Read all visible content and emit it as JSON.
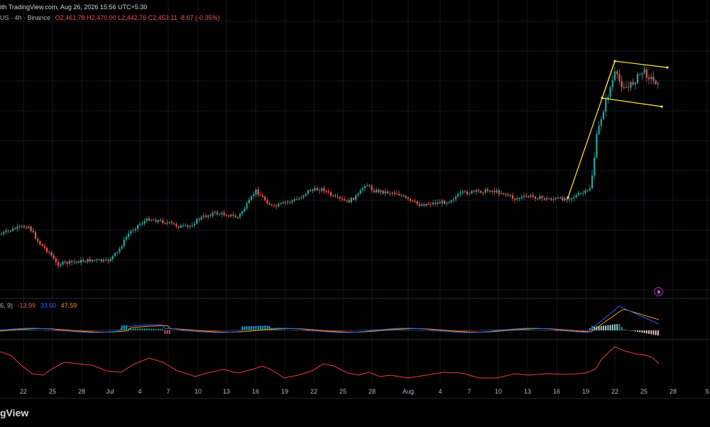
{
  "header": {
    "line1": "ith TradingView.com, Aug 26, 2026 15:56 UTC+5:30",
    "line2_symbol": "US · 4h · Binance",
    "line2_values": "O2,461.78  H2,470.00  L2,442.76  C2,453.11  -8.67 (-0.35%)"
  },
  "macd_legend": {
    "params": "6, 9)",
    "histogram": "-13.99",
    "macd": "33.60",
    "signal": "47.59"
  },
  "colors": {
    "up": "#26a69a",
    "down": "#ef5350",
    "pattern": "#ffeb3b",
    "macd": "#2962ff",
    "signal": "#ff9800",
    "rsi": "#f23645"
  },
  "icons": {
    "alert": "lightning-bolt-icon"
  },
  "x_axis": {
    "labels": [
      "22",
      "25",
      "28",
      "Jul",
      "4",
      "7",
      "10",
      "13",
      "16",
      "19",
      "22",
      "25",
      "28",
      "Aug",
      "4",
      "7",
      "10",
      "13",
      "16",
      "19",
      "22",
      "25",
      "28",
      "S"
    ]
  },
  "footer": {
    "brand": "gView"
  }
}
